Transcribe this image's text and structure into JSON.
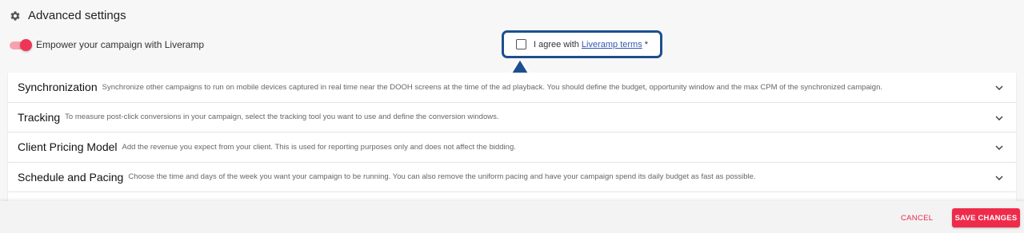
{
  "header": {
    "title": "Advanced settings",
    "icon": "gear-icon"
  },
  "liveramp": {
    "toggle_label": "Empower your campaign with Liveramp",
    "toggle_on": true,
    "agree_prefix": "I agree with ",
    "agree_link": "Liveramp terms",
    "agree_suffix": " *",
    "agree_checked": false
  },
  "sections": [
    {
      "title": "Synchronization",
      "description": "Synchronize other campaigns to run on mobile devices captured in real time near the DOOH screens at the time of the ad playback. You should define the budget, opportunity window and the max CPM of the synchronized campaign."
    },
    {
      "title": "Tracking",
      "description": "To measure post-click conversions in your campaign, select the tracking tool you want to use and define the conversion windows."
    },
    {
      "title": "Client Pricing Model",
      "description": "Add the revenue you expect from your client. This is used for reporting purposes only and does not affect the bidding."
    },
    {
      "title": "Schedule and Pacing",
      "description": "Choose the time and days of the week you want your campaign to be running. You can also remove the uniform pacing and have your campaign spend its daily budget as fast as possible."
    }
  ],
  "footer": {
    "cancel_label": "CANCEL",
    "save_label": "SAVE CHANGES"
  },
  "colors": {
    "accent": "#ee2b4b",
    "highlight": "#1d4f8f",
    "link": "#3557b0"
  }
}
